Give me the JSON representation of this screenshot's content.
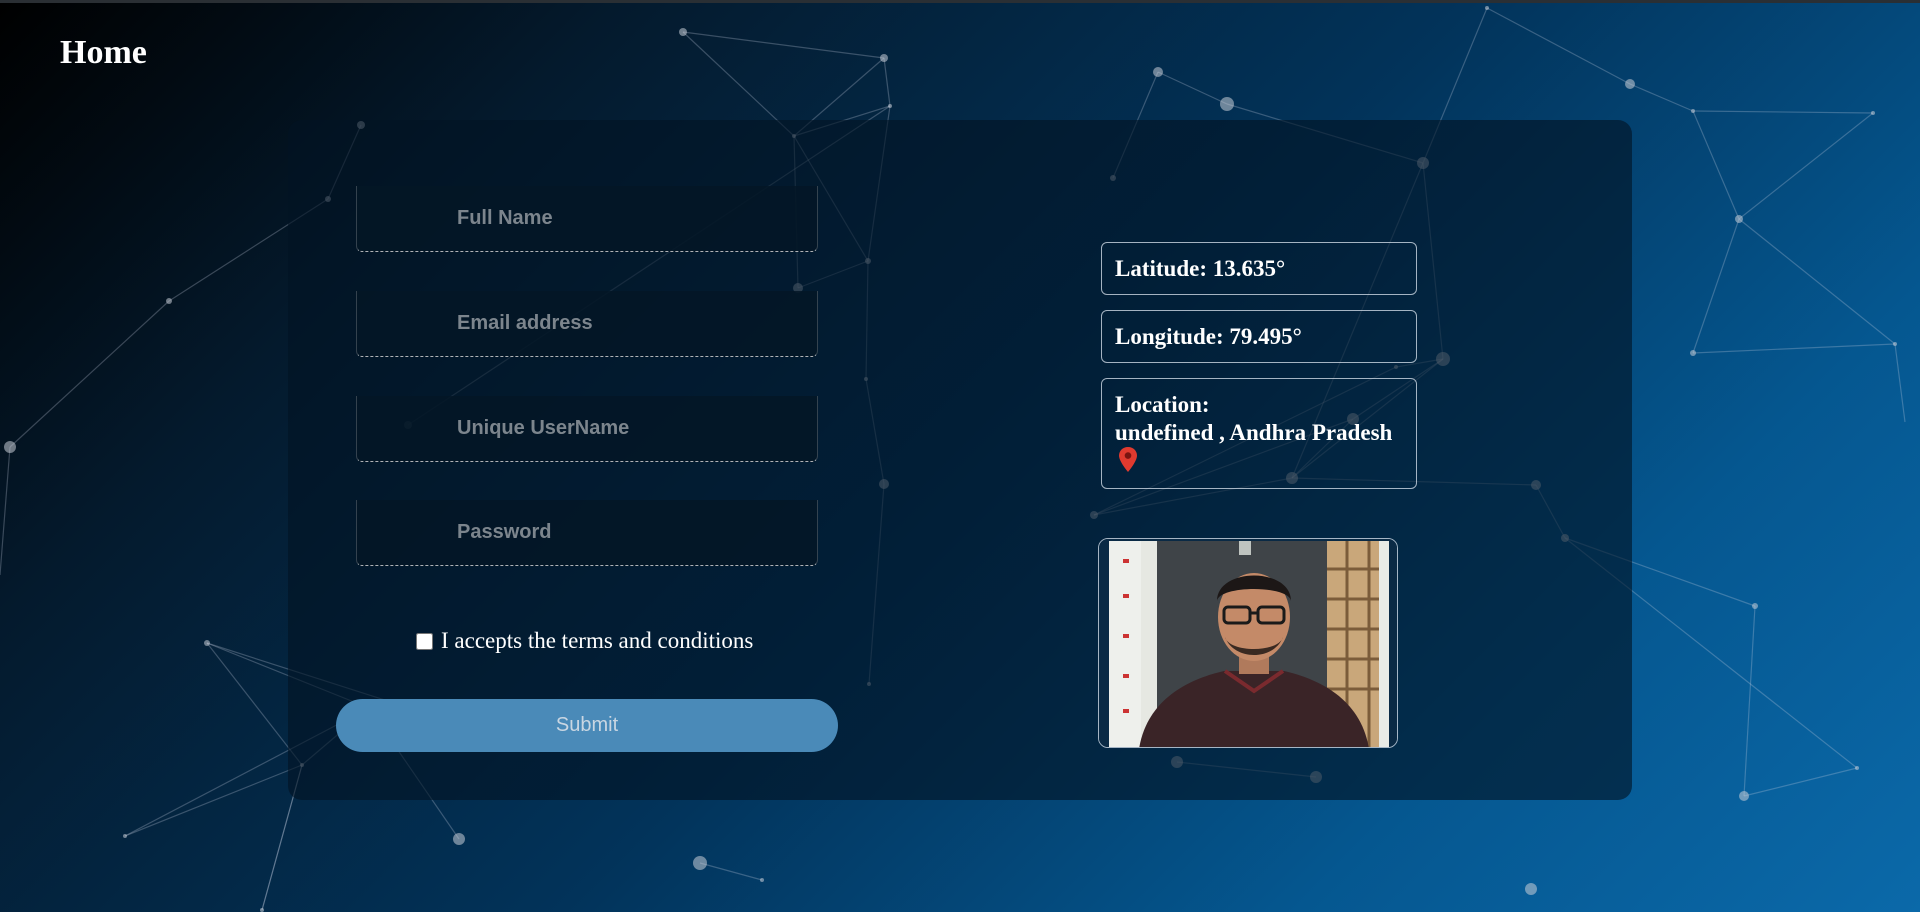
{
  "header": {
    "title": "Home"
  },
  "form": {
    "full_name_placeholder": "Full Name",
    "email_placeholder": "Email address",
    "username_placeholder": "Unique UserName",
    "password_placeholder": "Password",
    "terms_label": "I accepts the terms and conditions",
    "terms_checked": false,
    "submit_label": "Submit"
  },
  "location": {
    "latitude_text": "Latitude: 13.635°",
    "longitude_text": "Longitude: 79.495°",
    "location_label": "Location:",
    "location_value": "undefined , Andhra Pradesh",
    "pin_icon": "map-pin-icon"
  },
  "colors": {
    "submit_bg": "#4a8ab8",
    "pin": "#e03a2f",
    "text": "#ffffff"
  }
}
